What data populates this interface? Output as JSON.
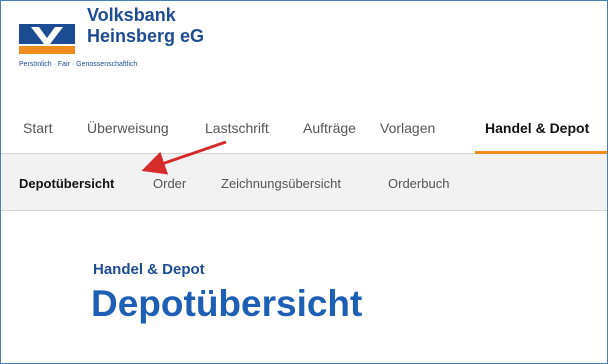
{
  "header": {
    "brand_line1": "Volksbank",
    "brand_line2": "Heinsberg eG",
    "tagline": "Persönlich · Fair · Genossenschaftlich",
    "logo_icon": "volksbank-logo-icon"
  },
  "mainnav": {
    "items": [
      {
        "label": "Start"
      },
      {
        "label": "Überweisung"
      },
      {
        "label": "Lastschrift"
      },
      {
        "label": "Aufträge"
      },
      {
        "label": "Vorlagen"
      },
      {
        "label": "Handel & Depot"
      }
    ],
    "active": "Handel & Depot"
  },
  "subnav": {
    "items": [
      {
        "label": "Depotübersicht"
      },
      {
        "label": "Order"
      },
      {
        "label": "Zeichnungsübersicht"
      },
      {
        "label": "Orderbuch"
      }
    ],
    "active": "Depotübersicht"
  },
  "content": {
    "overline": "Handel & Depot",
    "title": "Depotübersicht"
  },
  "colors": {
    "brand_blue": "#1c4d92",
    "title_blue": "#1c5fb4",
    "accent_orange": "#f08c1e",
    "annotation_red": "#d62b2b"
  }
}
